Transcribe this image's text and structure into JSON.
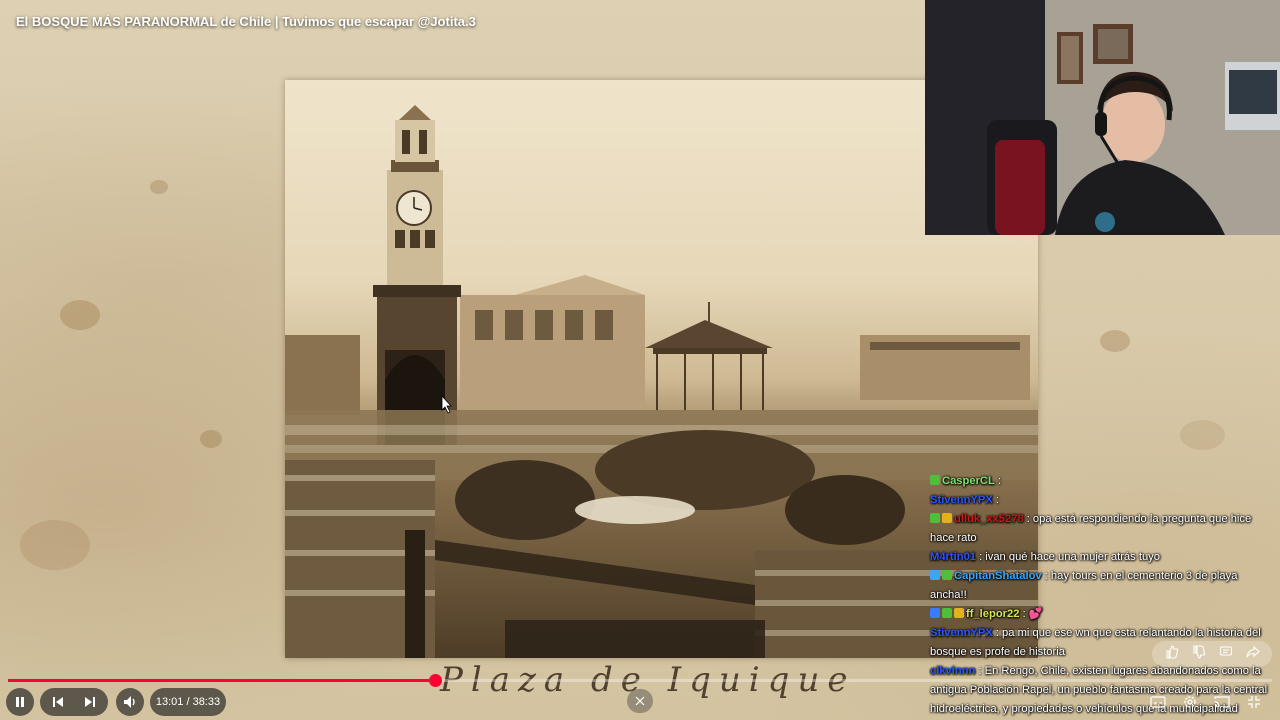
{
  "video": {
    "title": "El BOSQUE MÁS PARANORMAL de Chile | Tuvimos que escapar @Jotita.3",
    "photo_caption": "Plaza de Iquique"
  },
  "chat": {
    "messages": [
      {
        "user": "CasperCL",
        "text": "",
        "user_color": "#7ee36a",
        "badges": [
          "#4fbf3b"
        ]
      },
      {
        "user": "StivennYPX",
        "text": "",
        "user_color": "#2a55ff",
        "badges": []
      },
      {
        "user": "ulluk_xx5278",
        "text": "opa está respondiendo la pregunta que hice hace rato",
        "user_color": "#d01818",
        "badges": [
          "#4fbf3b",
          "#e3b21a"
        ]
      },
      {
        "user": "M4rtin01",
        "text": "ivan qué hace una mujer atrás tuyo",
        "user_color": "#2a55ff",
        "badges": []
      },
      {
        "user": "CapitanShatalov",
        "text": "hay tours en el cementerio 3 de playa ancha!!",
        "user_color": "#3aa6ff",
        "badges": [
          "#3aa6ff",
          "#4fbf3b"
        ]
      },
      {
        "user": "ff_lepor22",
        "text": "💕",
        "user_color": "#d5e84a",
        "badges": [
          "#3a7bff",
          "#4fbf3b",
          "#e3b21a"
        ]
      },
      {
        "user": "StivennYPX",
        "text": "pa mi que ese wn que esta relantando la historia del bosque es profe de historia",
        "user_color": "#2a55ff",
        "badges": []
      },
      {
        "user": "clkvinnn",
        "text": "En Rengo, Chile, existen lugares abandonados como la antigua Población Rapel, un pueblo fantasma creado para la central hidroeléctrica, y propiedades o vehículos que la municipalidad permite denunciar para mejorar el entorno",
        "user_color": "#2a55ff",
        "badges": []
      }
    ]
  },
  "player": {
    "current_time": "13:01",
    "duration": "38:33",
    "time_display": "13:01 / 38:33",
    "progress_fraction": 0.338,
    "accent_color": "#ff0033",
    "icons": [
      "pause-icon",
      "previous-icon",
      "next-icon",
      "volume-icon",
      "chevron-down-icon",
      "subtitles-icon",
      "settings-icon",
      "cast-icon",
      "exit-fullscreen-icon"
    ]
  }
}
